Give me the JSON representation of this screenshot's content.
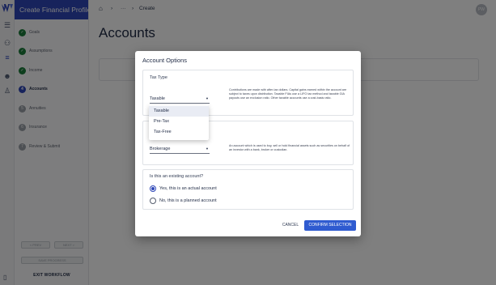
{
  "sidebar": {
    "title": "Create Financial Profile",
    "steps": [
      {
        "label": "Goals",
        "state": "done"
      },
      {
        "label": "Assumptions",
        "state": "done"
      },
      {
        "label": "Income",
        "state": "done"
      },
      {
        "label": "Accounts",
        "state": "active",
        "number": "4"
      },
      {
        "label": "Annuities",
        "state": "todo",
        "number": "5"
      },
      {
        "label": "Insurance",
        "state": "todo",
        "number": "6"
      },
      {
        "label": "Review & Submit",
        "state": "todo",
        "number": "7"
      }
    ],
    "prev_label": "< PREV",
    "next_label": "NEXT >",
    "save_label": "SAVE PROGRESS",
    "exit_label": "EXIT WORKFLOW"
  },
  "topbar": {
    "breadcrumb_ellipsis": "···",
    "breadcrumb_current": "Create",
    "avatar_initials": "PW"
  },
  "page": {
    "title": "Accounts"
  },
  "modal": {
    "title": "Account Options",
    "tax_type": {
      "label": "Tax Type",
      "value": "Taxable",
      "description": "Contributions are made with after-tax dollars. Capital gains earned within the account are subject to taxes upon distribution. Taxable FIAs use a LIFO tax method and taxable GIA payouts use an exclusion ratio. Other taxable accounts use a cost-basis ratio.",
      "options": [
        "Taxable",
        "Pre-Tax",
        "Tax-Free"
      ]
    },
    "account_type": {
      "value": "Brokerage",
      "description": "An account which is used to buy, sell or hold financial assets such as securities on behalf of an investor with a bank, broker or custodian."
    },
    "existing": {
      "question": "Is this an existing account?",
      "options": [
        {
          "label": "Yes, this is an actual account",
          "selected": true
        },
        {
          "label": "No, this is a planned account",
          "selected": false
        }
      ]
    },
    "cancel_label": "CANCEL",
    "confirm_label": "CONFIRM SELECTION"
  },
  "colors": {
    "brand": "#2f47b8",
    "confirm": "#2f5bd0",
    "done": "#1a7d3a"
  }
}
